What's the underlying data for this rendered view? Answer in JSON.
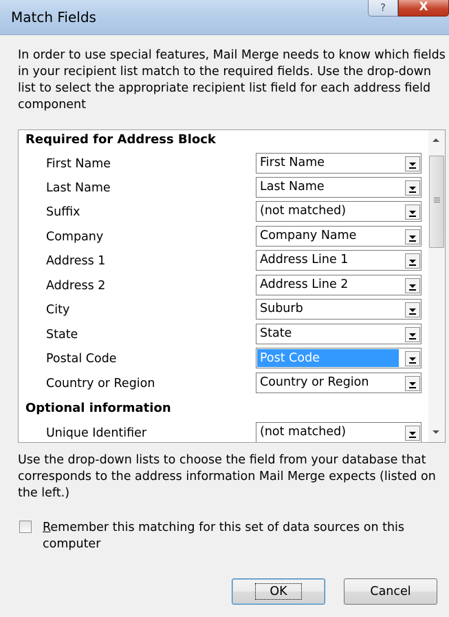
{
  "window": {
    "title": "Match Fields",
    "help_glyph": "?",
    "close_glyph": "X"
  },
  "intro_text": "In order to use special features, Mail Merge needs to know which fields in your recipient list match to the required fields.  Use the drop-down list to select the appropriate recipient list field for each address field component",
  "required_section": {
    "header": "Required for Address Block",
    "rows": [
      {
        "label": "First Name",
        "value": "First Name"
      },
      {
        "label": "Last Name",
        "value": "Last Name"
      },
      {
        "label": "Suffix",
        "value": "(not matched)"
      },
      {
        "label": "Company",
        "value": "Company Name"
      },
      {
        "label": "Address 1",
        "value": "Address Line 1"
      },
      {
        "label": "Address 2",
        "value": "Address Line 2"
      },
      {
        "label": "City",
        "value": "Suburb"
      },
      {
        "label": "State",
        "value": "State"
      },
      {
        "label": "Postal Code",
        "value": "Post Code",
        "selected": true
      },
      {
        "label": "Country or Region",
        "value": "Country or Region"
      }
    ]
  },
  "optional_section": {
    "header": "Optional information",
    "rows": [
      {
        "label": "Unique Identifier",
        "value": "(not matched)"
      }
    ]
  },
  "footer_text": "Use the drop-down lists to choose the field from your database that corresponds to the address information Mail Merge expects (listed on the left.)",
  "remember_checkbox": {
    "label_first": "R",
    "label_rest": "emember this matching for this set of data sources on this computer",
    "checked": false
  },
  "buttons": {
    "ok": "OK",
    "cancel": "Cancel"
  },
  "colors": {
    "selection": "#3399ff",
    "titlebar": "#b7cfea",
    "close_button": "#c4442b"
  }
}
